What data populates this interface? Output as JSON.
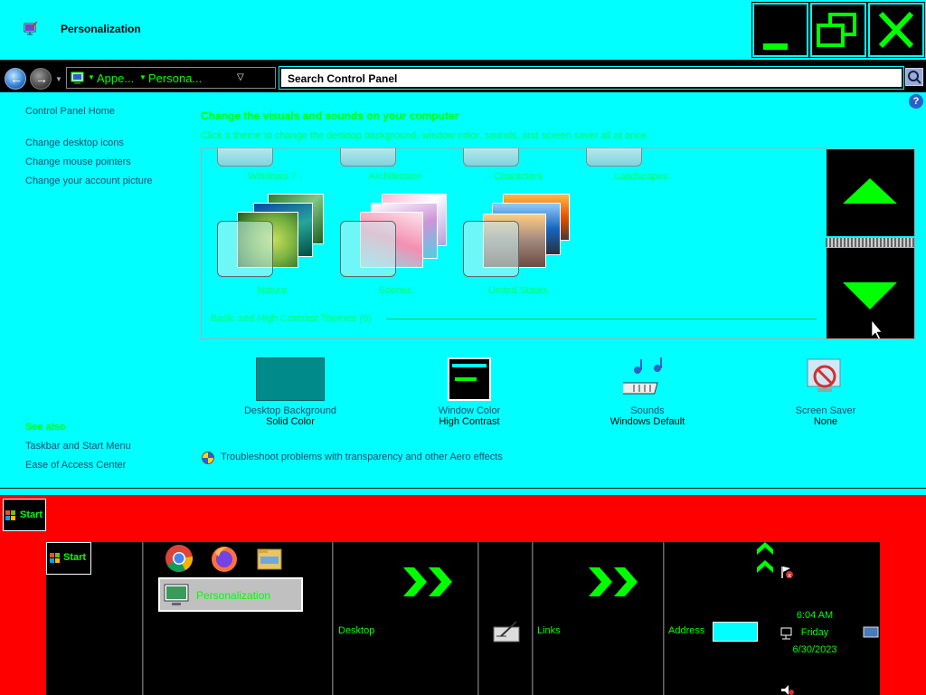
{
  "window": {
    "title": "Personalization",
    "buttons": [
      "minimize",
      "maximize",
      "close"
    ]
  },
  "address_bar": {
    "breadcrumb": [
      "Appe...",
      "Persona..."
    ],
    "search_placeholder": "Search Control Panel"
  },
  "sidebar": {
    "home": "Control Panel Home",
    "links": [
      "Change desktop icons",
      "Change mouse pointers",
      "Change your account picture"
    ],
    "see_also_title": "See also",
    "see_also_links": [
      "Taskbar and Start Menu",
      "Ease of Access Center"
    ]
  },
  "main": {
    "heading": "Change the visuals and sounds on your computer",
    "subheading": "Click a theme to change the desktop background, window color, sounds, and screen saver all at once.",
    "themes_top_row": [
      "Windows 7",
      "Architecture",
      "Characters",
      "Landscapes"
    ],
    "themes_second_row": [
      "Nature",
      "Scenes",
      "United States"
    ],
    "section_basic": "Basic and High Contrast Themes (6)"
  },
  "customizations": [
    {
      "name": "Desktop Background",
      "value": "Solid Color",
      "icon": "desktop-background-icon"
    },
    {
      "name": "Window Color",
      "value": "High Contrast",
      "icon": "window-color-icon"
    },
    {
      "name": "Sounds",
      "value": "Windows Default",
      "icon": "sounds-icon"
    },
    {
      "name": "Screen Saver",
      "value": "None",
      "icon": "screen-saver-icon"
    }
  ],
  "troubleshoot": "Troubleshoot problems with transparency and other Aero effects",
  "taskbar": {
    "start_label": "Start",
    "inner_start_label": "Start",
    "quick_launch": [
      "chrome-icon",
      "firefox-icon",
      "file-explorer-icon"
    ],
    "task_label": "Personalization",
    "toolbars": [
      "Desktop",
      "Links",
      "Address"
    ],
    "time": "6:04 AM",
    "day": "Friday",
    "date": "6/30/2023"
  },
  "colors": {
    "background": "#00ffff",
    "accent": "#00ff00",
    "taskbar": "#ff0000",
    "dark": "#000000"
  }
}
